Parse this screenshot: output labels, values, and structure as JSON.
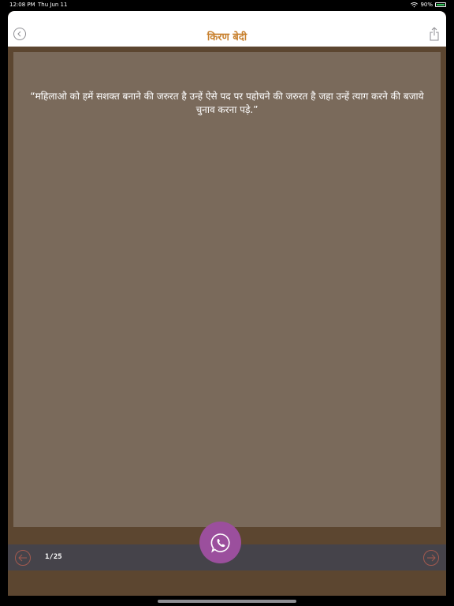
{
  "status_bar": {
    "time": "12:08 PM",
    "date": "Thu Jun 11",
    "battery": "90%"
  },
  "nav": {
    "title": "किरण बेदी",
    "back_icon": "chevron-left-circle-icon",
    "share_icon": "share-icon"
  },
  "quote": {
    "text": "“महिलाओ को हमें सशक्त बनाने की जरुरत है उन्हें ऐसे पद पर पहोचने की जरुरत है जहा उन्हें त्याग करने की बजाये चुनाव करना पड़े.”"
  },
  "pager": {
    "counter": "1/25",
    "prev_icon": "arrow-left-circle-icon",
    "next_icon": "arrow-right-circle-icon"
  },
  "share_action": {
    "icon": "whatsapp-icon"
  },
  "colors": {
    "title": "#c8812f",
    "panel": "#7a6a5b",
    "frame": "#5c4630",
    "bottom_bar": "#45434a",
    "whatsapp_button": "#9b4f9d",
    "nav_arrows": "#a25a4f"
  }
}
